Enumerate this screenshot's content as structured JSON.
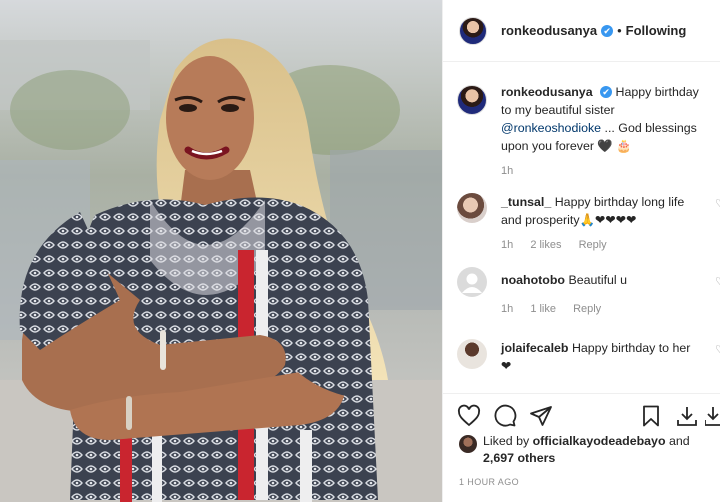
{
  "post": {
    "username": "ronkeodusanya",
    "verified_mark": "✔",
    "separator": "•",
    "follow_state": "Following"
  },
  "caption": {
    "username": "ronkeodusanya",
    "text_before": "Happy birthday to my beautiful sister",
    "mention": "@ronkeoshodioke",
    "text_after": "... God blessings upon you forever 🖤 🎂",
    "time": "1h"
  },
  "comments": [
    {
      "username": "_tunsal_",
      "text": "Happy birthday long life and prosperity🙏❤❤❤❤",
      "time": "1h",
      "likes": "2 likes",
      "reply": "Reply",
      "avatar_color": "#c9a58f"
    },
    {
      "username": "noahotobo",
      "text": "Beautiful u",
      "time": "1h",
      "likes": "1 like",
      "reply": "Reply",
      "avatar_color": "#dbdbdb"
    },
    {
      "username": "jolaifecaleb",
      "text": "Happy birthday to her❤",
      "time": "",
      "likes": "",
      "reply": "",
      "avatar_color": "#6b4a3b"
    }
  ],
  "actions": {
    "icons": [
      "heart-icon",
      "comment-icon",
      "share-icon",
      "bookmark-icon",
      "download-icon"
    ]
  },
  "likes": {
    "prefix": "Liked by",
    "user": "officialkayodeadebayo",
    "conjunction": "and",
    "others": "2,697 others"
  },
  "timestamp": "1 HOUR AGO"
}
